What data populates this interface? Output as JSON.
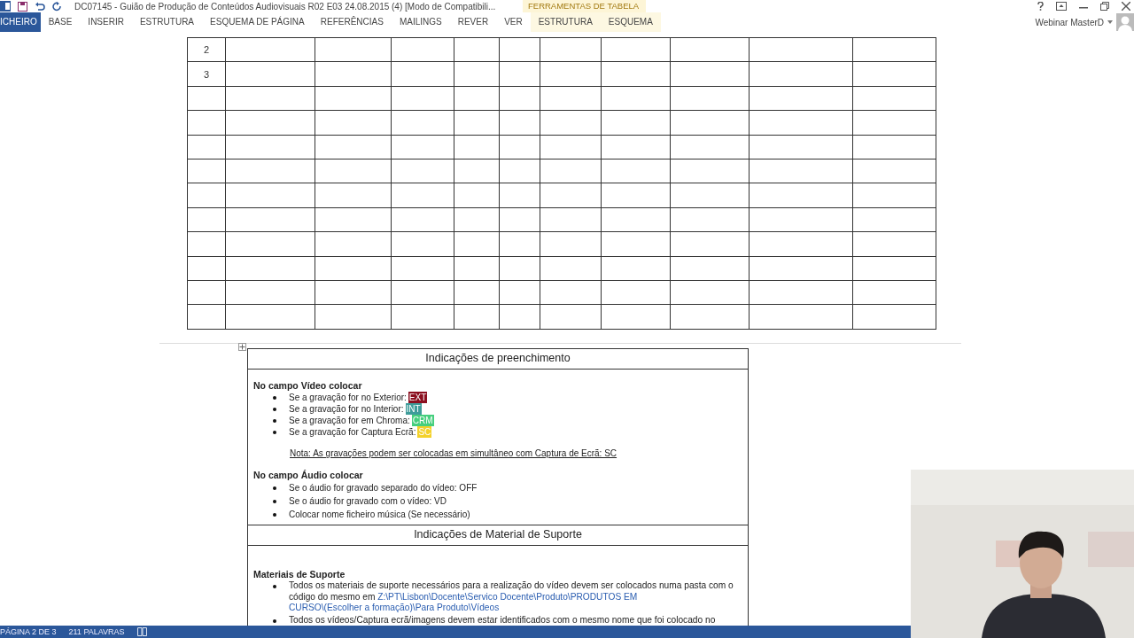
{
  "title_bar": {
    "title": "DC07145 - Guião de Produção de Conteúdos Audiovisuais R02 E03 24.08.2015 (4) [Modo de Compatibili...",
    "tool_group": "FERRAMENTAS DE TABELA"
  },
  "ribbon_tabs": [
    {
      "label": "ICHEIRO",
      "selected": true,
      "contextual": false
    },
    {
      "label": "BASE",
      "selected": false,
      "contextual": false
    },
    {
      "label": "INSERIR",
      "selected": false,
      "contextual": false
    },
    {
      "label": "ESTRUTURA",
      "selected": false,
      "contextual": false
    },
    {
      "label": "ESQUEMA DE PÁGINA",
      "selected": false,
      "contextual": false
    },
    {
      "label": "REFERÊNCIAS",
      "selected": false,
      "contextual": false
    },
    {
      "label": "MAILINGS",
      "selected": false,
      "contextual": false
    },
    {
      "label": "REVER",
      "selected": false,
      "contextual": false
    },
    {
      "label": "VER",
      "selected": false,
      "contextual": false
    },
    {
      "label": "ESTRUTURA",
      "selected": false,
      "contextual": true
    },
    {
      "label": "ESQUEMA",
      "selected": false,
      "contextual": true
    }
  ],
  "account": {
    "name": "Webinar MasterD"
  },
  "table": {
    "rows": [
      {
        "number": "2"
      },
      {
        "number": "3"
      }
    ]
  },
  "fill_section": {
    "title": "Indicações de preenchimento",
    "video_heading": "No campo Vídeo colocar",
    "video_items": [
      {
        "text": "Se a gravação for no Exterior:",
        "tag": "EXT",
        "color": "#8b1020"
      },
      {
        "text": "Se a gravação for no Interior:",
        "tag": "INT",
        "color": "#3e9c9a"
      },
      {
        "text": "Se a gravação for em Chroma:",
        "tag": "CRM",
        "color": "#46cf7e"
      },
      {
        "text": "Se a gravação for Captura Ecrã:",
        "tag": "SC",
        "color": "#f3d12a"
      }
    ],
    "note": "Nota: As gravações podem ser colocadas em simultâneo com Captura de Ecrã: SC",
    "audio_heading": "No campo Áudio colocar",
    "audio_items": [
      "Se o áudio for gravado separado do vídeo: OFF",
      "Se o áudio for gravado com o vídeo: VD",
      "Colocar nome ficheiro música (Se necessário)"
    ]
  },
  "support_section": {
    "title": "Indicações de Material de Suporte",
    "heading": "Materiais de Suporte",
    "items": [
      {
        "text": "Todos os materiais de suporte necessários para a realização do vídeo devem ser colocados numa pasta com o código do mesmo em ",
        "link_lines": [
          "Z:\\PT\\Lisbon\\Docente\\Servico Docente\\Produto\\PRODUTOS EM",
          "CURSO\\(Escolher a formação)\\Para Produto\\Vídeos"
        ]
      },
      {
        "text": "Todos os vídeos/Captura ecrã/imagens devem estar identificados com o mesmo nome que foi colocado no"
      }
    ]
  },
  "status_bar": {
    "page": "PÁGINA 2 DE 3",
    "words": "211 PALAVRAS"
  }
}
